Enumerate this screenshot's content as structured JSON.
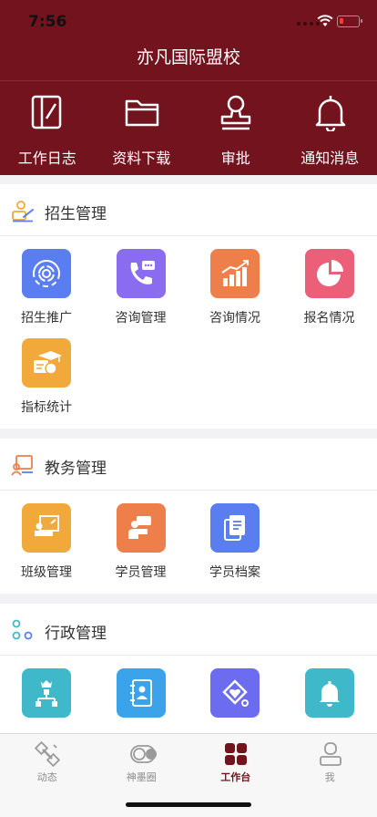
{
  "status_bar": {
    "time": "7:56"
  },
  "nav": {
    "title": "亦凡国际盟校"
  },
  "quick_actions": [
    {
      "label": "工作日志",
      "icon": "journal-icon"
    },
    {
      "label": "资料下载",
      "icon": "folder-icon"
    },
    {
      "label": "审批",
      "icon": "stamp-icon"
    },
    {
      "label": "通知消息",
      "icon": "bell-icon"
    }
  ],
  "sections": {
    "enrollment": {
      "title": "招生管理",
      "items": [
        {
          "label": "招生推广",
          "icon": "broadcast-icon",
          "color": "#5a7ef0"
        },
        {
          "label": "咨询管理",
          "icon": "phone-chat-icon",
          "color": "#8a6cf0"
        },
        {
          "label": "咨询情况",
          "icon": "bar-chart-icon",
          "color": "#ee7f4a"
        },
        {
          "label": "报名情况",
          "icon": "pie-chart-icon",
          "color": "#ec5f78"
        },
        {
          "label": "指标统计",
          "icon": "graduation-cap-icon",
          "color": "#f2a93b"
        }
      ]
    },
    "academic": {
      "title": "教务管理",
      "items": [
        {
          "label": "班级管理",
          "icon": "classroom-icon",
          "color": "#f2a93b"
        },
        {
          "label": "学员管理",
          "icon": "student-icon",
          "color": "#ee7f4a"
        },
        {
          "label": "学员档案",
          "icon": "documents-icon",
          "color": "#5a7ef0"
        }
      ]
    },
    "admin": {
      "title": "行政管理",
      "items": [
        {
          "label": "",
          "icon": "org-chart-icon",
          "color": "#3fb8c9"
        },
        {
          "label": "",
          "icon": "contacts-icon",
          "color": "#3aa3ea"
        },
        {
          "label": "",
          "icon": "heart-shield-icon",
          "color": "#6c6cf0"
        },
        {
          "label": "",
          "icon": "bell-icon",
          "color": "#3fb8c9"
        }
      ]
    }
  },
  "tabbar": [
    {
      "label": "动态",
      "icon": "satellite-icon",
      "active": false
    },
    {
      "label": "神墨圈",
      "icon": "toggle-icon",
      "active": false
    },
    {
      "label": "工作台",
      "icon": "grid-icon",
      "active": true
    },
    {
      "label": "我",
      "icon": "person-icon",
      "active": false
    }
  ],
  "colors": {
    "brand": "#72131e",
    "background": "#f2f2f4"
  }
}
